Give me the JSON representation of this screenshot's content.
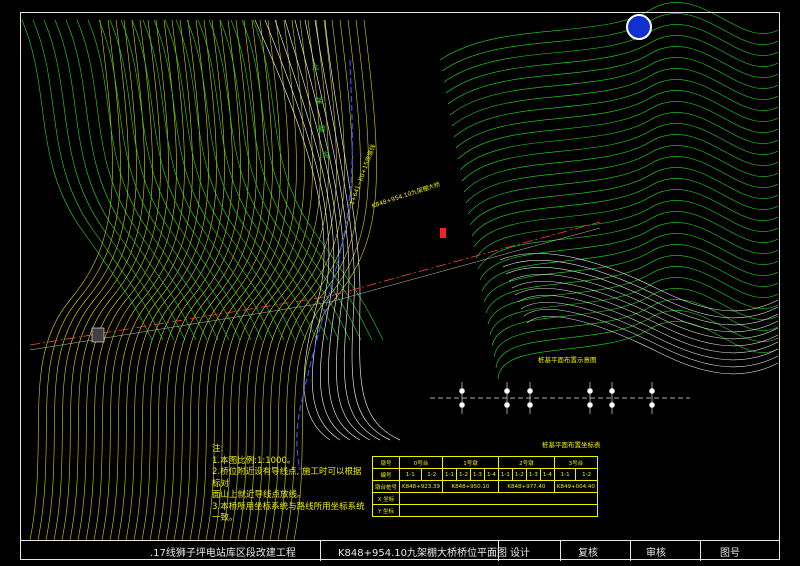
{
  "notes": {
    "title": "注:",
    "lines": [
      "1.本图比例:1:1000。",
      "2.桥位附近设有导线点, 施工时可以根据标对",
      "   面山上就近导线点放线。",
      "3.本桥所用坐标系统与路线所用坐标系统一致。"
    ]
  },
  "pier_layout_title": "桩基平面布置示意图",
  "coord_table": {
    "title": "桩基平面布置坐标表",
    "header": [
      "墩号",
      "0号台",
      "1号墩",
      "2号墩",
      "3号台"
    ],
    "row_labels": [
      "编号",
      "墩台桩号",
      "X 坐标",
      "Y 坐标"
    ],
    "pile_numbers": [
      "1-1",
      "1-2",
      "1-1",
      "1-2",
      "1-3",
      "1-4",
      "1-1",
      "1-2",
      "1-3",
      "1-4",
      "1-1",
      "1-2"
    ],
    "station_values": [
      "K848+923.39",
      "K848+950.10",
      "K848+977.40",
      "K849+004.40"
    ]
  },
  "title_bar": {
    "project": ".17线狮子坪电站库区段改建工程",
    "drawing": "K848+954.10九架棚大桥桥位平面图",
    "design": "设计",
    "review": "复核",
    "approve": "审核",
    "drawing_no": "图号"
  },
  "map_labels": {
    "bridge": "K848+954.10九架棚大桥",
    "river1": "九",
    "river2": "架",
    "river3": "棚",
    "river4": "沟",
    "road": "1+641~K0+15改道线"
  },
  "colors": {
    "contour_yellow": "#d8d800",
    "contour_green": "#22e022",
    "river_blue": "#3050ff",
    "road_red": "#ff4040",
    "frame": "#e8e8e8"
  }
}
